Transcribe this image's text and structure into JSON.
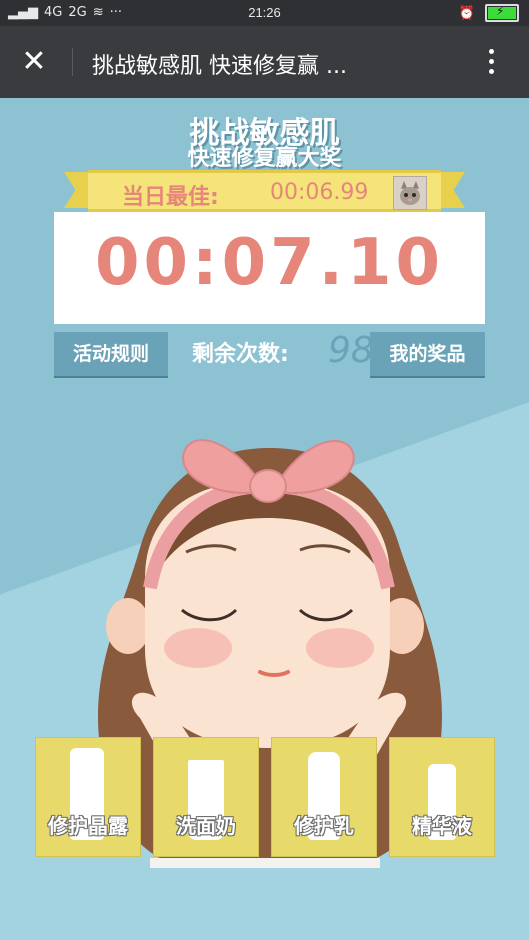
{
  "status_bar": {
    "network_1": "4G",
    "network_2": "2G",
    "time": "21:26",
    "more": "···"
  },
  "nav": {
    "close_icon": "close-icon",
    "title": "挑战敏感肌 快速修复赢 ...",
    "more_icon": "more-vertical-icon"
  },
  "headline": {
    "line1": "挑战敏感肌",
    "line2": "快速修复赢大奖"
  },
  "best": {
    "label": "当日最佳:",
    "time": "00:06.99"
  },
  "timer": {
    "value": "00:07.10"
  },
  "actions": {
    "rules_label": "活动规则",
    "remaining_label": "剩余次数:",
    "remaining_count": "98",
    "prizes_label": "我的奖品"
  },
  "products": [
    {
      "name": "修护晶露"
    },
    {
      "name": "洗面奶"
    },
    {
      "name": "修护乳"
    },
    {
      "name": "精华液"
    }
  ],
  "colors": {
    "accent_pink": "#e6867a",
    "ribbon_yellow": "#f5e47a",
    "button_blue": "#6aa3b8",
    "background_blue": "#9fd0de"
  }
}
